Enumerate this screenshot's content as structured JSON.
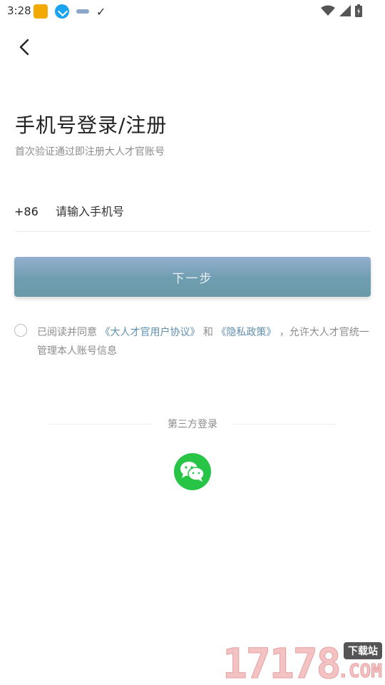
{
  "status_bar": {
    "time": "3:28"
  },
  "header": {
    "title": "手机号登录/注册",
    "subtitle": "首次验证通过即注册大人才官账号"
  },
  "phone": {
    "country_code": "+86",
    "placeholder": "请输入手机号",
    "value": ""
  },
  "next_button": {
    "label": "下一步"
  },
  "agreement": {
    "prefix": "已阅读并同意 ",
    "user_agreement": "《大人才官用户协议》",
    "and": " 和 ",
    "privacy_policy": "《隐私政策》",
    "suffix": " ，允许大人才官统一管理本人账号信息",
    "checked": false
  },
  "third_party": {
    "label": "第三方登录",
    "wechat_icon": "wechat-icon"
  },
  "watermark": {
    "digits": "17178",
    "badge": "下载站",
    "domain": ".COM"
  },
  "colors": {
    "link": "#5f8fb0",
    "wechat": "#28c445",
    "button_top": "#93b0cf",
    "button_bottom": "#6a9aa8"
  }
}
